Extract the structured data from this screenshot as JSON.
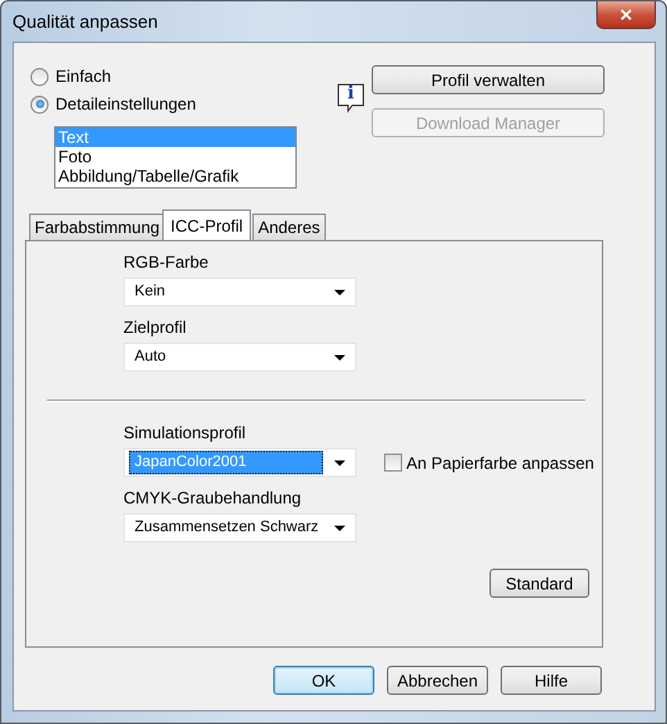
{
  "window": {
    "title": "Qualität anpassen",
    "close": "✕"
  },
  "modes": [
    {
      "label": "Einfach",
      "selected": false
    },
    {
      "label": "Detaileinstellungen",
      "selected": true
    }
  ],
  "list": [
    {
      "label": "Text",
      "selected": true
    },
    {
      "label": "Foto",
      "selected": false
    },
    {
      "label": "Abbildung/Tabelle/Grafik",
      "selected": false
    }
  ],
  "side_buttons": [
    {
      "label": "Profil verwalten",
      "disabled": false
    },
    {
      "label": "Download Manager",
      "disabled": true
    }
  ],
  "info_icon": "i",
  "tabs": [
    {
      "label": "Farbabstimmung",
      "selected": false
    },
    {
      "label": "ICC-Profil",
      "selected": true
    },
    {
      "label": "Anderes",
      "selected": false
    }
  ],
  "fields": [
    {
      "label": "RGB-Farbe",
      "value": "Kein",
      "focused": false
    },
    {
      "label": "Zielprofil",
      "value": "Auto",
      "focused": false
    }
  ],
  "fields_2": [
    {
      "label": "Simulationsprofil",
      "value": "JapanColor2001",
      "focused": true,
      "checkbox": {
        "label": "An Papierfarbe anpassen",
        "checked": false
      }
    },
    {
      "label": "CMYK-Graubehandlung",
      "value": "Zusammensetzen Schwarz",
      "focused": false
    }
  ],
  "standard_button": "Standard",
  "buttons": [
    {
      "label": "OK",
      "default": true
    },
    {
      "label": "Abbrechen",
      "default": false
    },
    {
      "label": "Hilfe",
      "default": false
    }
  ]
}
